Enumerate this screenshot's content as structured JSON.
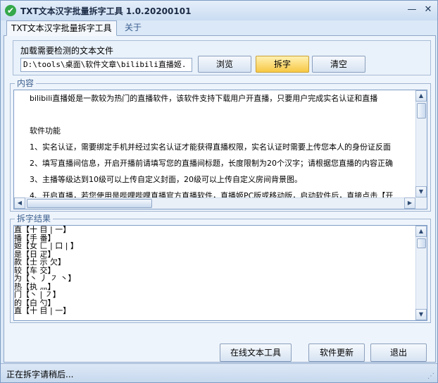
{
  "window": {
    "title": "TXT文本汉字批量拆字工具 1.0.20200101",
    "minimize_glyph": "—",
    "close_glyph": "✕",
    "app_icon_glyph": "✔"
  },
  "tabs": [
    {
      "label": "TXT文本汉字批量拆字工具",
      "active": true
    },
    {
      "label": "关于",
      "active": false
    }
  ],
  "load": {
    "label": "加载需要检测的文本文件",
    "path_value": "D:\\tools\\桌面\\软件文章\\bilibili直播姬.",
    "browse_label": "浏览",
    "split_label": "拆字",
    "clear_label": "清空"
  },
  "content_section": {
    "label": "内容",
    "lines": [
      "bilibili直播姬是一款较为热门的直播软件，该软件支持下载用户开直播，只要用户完成实名认证和直播",
      "",
      "软件功能",
      "1、实名认证，需要绑定手机并经过实名认证才能获得直播权限，实名认证时需要上传您本人的身份证反面",
      "2、填写直播间信息，开启开播前请填写您的直播间标题，长度限制为20个汉字；请根据您直播的内容正确",
      "3、主播等级达到10级可以上传自定义封面，20级可以上传自定义房间背景图。",
      "4、开启直播，若您使用是哔哩哔哩直播官方直播软件，直播姬PC版或移动版，启动软件后，直接点击【开"
    ]
  },
  "result_section": {
    "label": "拆字结果",
    "lines": [
      "直【十 目 | 一】",
      "播【手 番】",
      "姬【女 匚 | 口 | 】",
      "是【日 疋】",
      "款【士 示 欠】",
      "较【车 交】",
      "为【丶 丿 ㇇ 丶】",
      "热【执 灬】",
      "门【丶 | ㇇】",
      "的【白 勺】",
      "直【十 目 | 一】"
    ]
  },
  "footer": {
    "online_label": "在线文本工具",
    "update_label": "软件更新",
    "exit_label": "退出"
  },
  "status": {
    "text": "正在拆字请稍后..."
  },
  "colors": {
    "accent": "#f7c844",
    "border": "#8fa7c8",
    "background": "#dbe8f7"
  }
}
